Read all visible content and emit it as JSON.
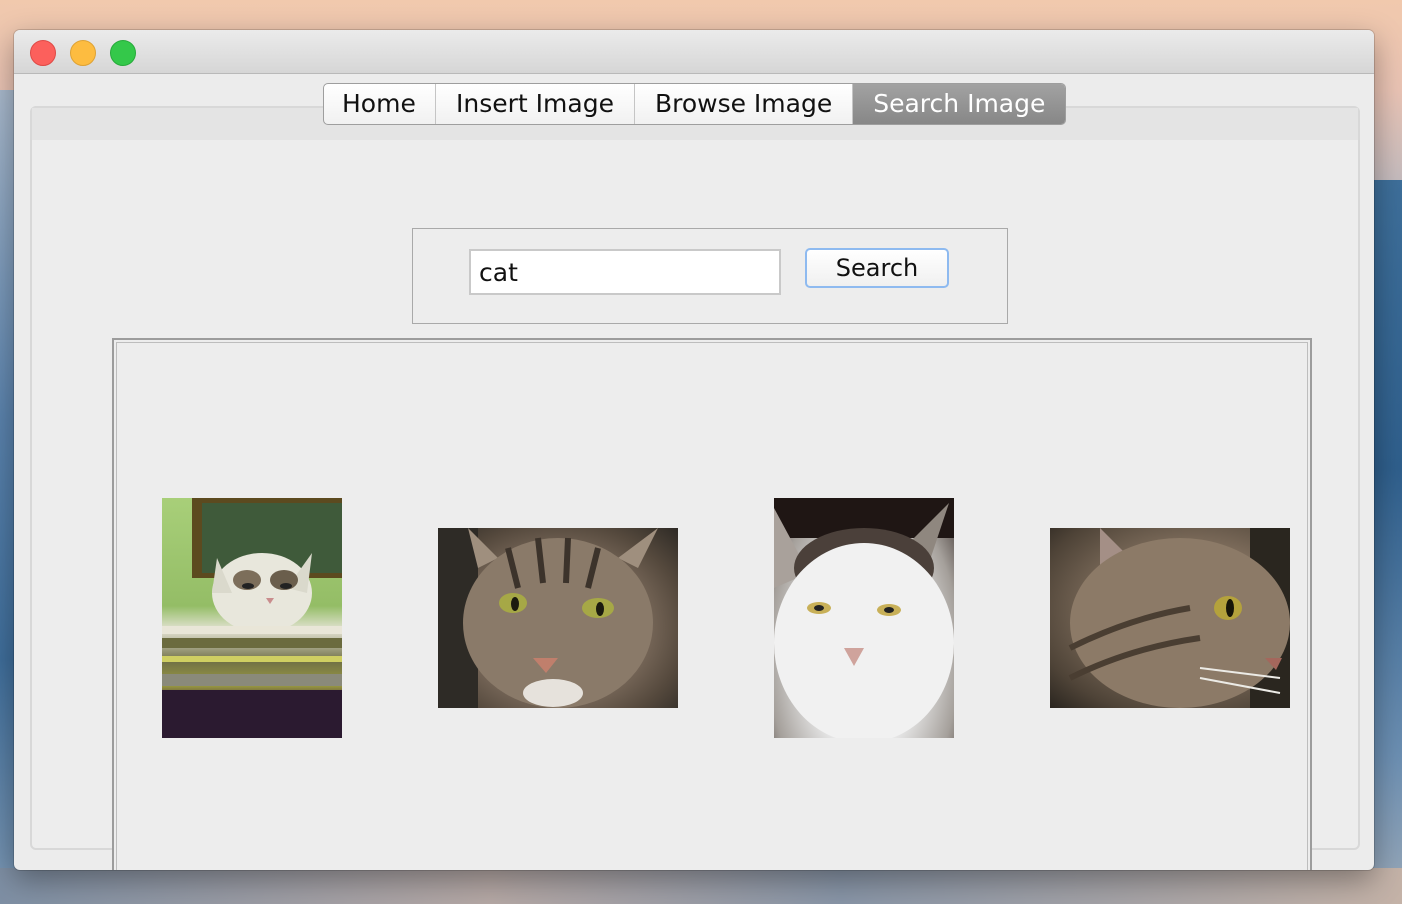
{
  "tabs": [
    {
      "label": "Home",
      "active": false
    },
    {
      "label": "Insert Image",
      "active": false
    },
    {
      "label": "Browse Image",
      "active": false
    },
    {
      "label": "Search Image",
      "active": true
    }
  ],
  "search": {
    "query": "cat",
    "button_label": "Search"
  },
  "results": {
    "items": [
      {
        "icon": "cat-photo"
      },
      {
        "icon": "cat-photo"
      },
      {
        "icon": "cat-photo"
      },
      {
        "icon": "cat-photo"
      }
    ]
  },
  "colors": {
    "close": "#fc605c",
    "minimize": "#fdbc40",
    "maximize": "#34c84a",
    "active_tab": "#8f8f8f",
    "button_focus": "#8ebaf0"
  }
}
